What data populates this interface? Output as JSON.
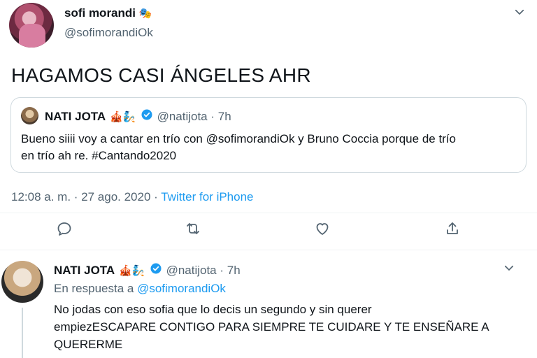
{
  "tweet": {
    "author_name": "sofi morandi",
    "author_emoji": "🎭",
    "author_handle": "@sofimorandiOk",
    "text": "HAGAMOS CASI ÁNGELES AHR",
    "timestamp": "12:08 a. m. · 27 ago. 2020 · ",
    "source": "Twitter for iPhone"
  },
  "quote": {
    "author_name": "NATI JOTA",
    "author_emoji": "🎪🧞",
    "author_handle": "@natijota · 7h",
    "text_line1": "Bueno siiii voy a cantar en trío con @sofimorandiOk y Bruno Coccia porque de trío",
    "text_line2": "en trío ah re. #Cantando2020"
  },
  "actions": [
    {
      "icon": "reply-icon"
    },
    {
      "icon": "retweet-icon"
    },
    {
      "icon": "like-icon"
    },
    {
      "icon": "share-icon"
    }
  ],
  "reply": {
    "author_name": "NATI JOTA",
    "author_emoji": "🎪🧞",
    "author_handle": "@natijota · 7h",
    "replying_to_label": "En respuesta a ",
    "replying_to_handle": "@sofimorandiOk",
    "text_line1": "No jodas con eso sofia que lo decis un segundo y sin querer",
    "text_line2": "empiezESCAPARE CONTIGO PARA SIEMPRE TE CUIDARE Y TE ENSEÑARE A",
    "text_line3": "QUERERME"
  },
  "colors": {
    "accent": "#1d9bf0",
    "muted": "#536471",
    "border": "#cfd9de"
  }
}
